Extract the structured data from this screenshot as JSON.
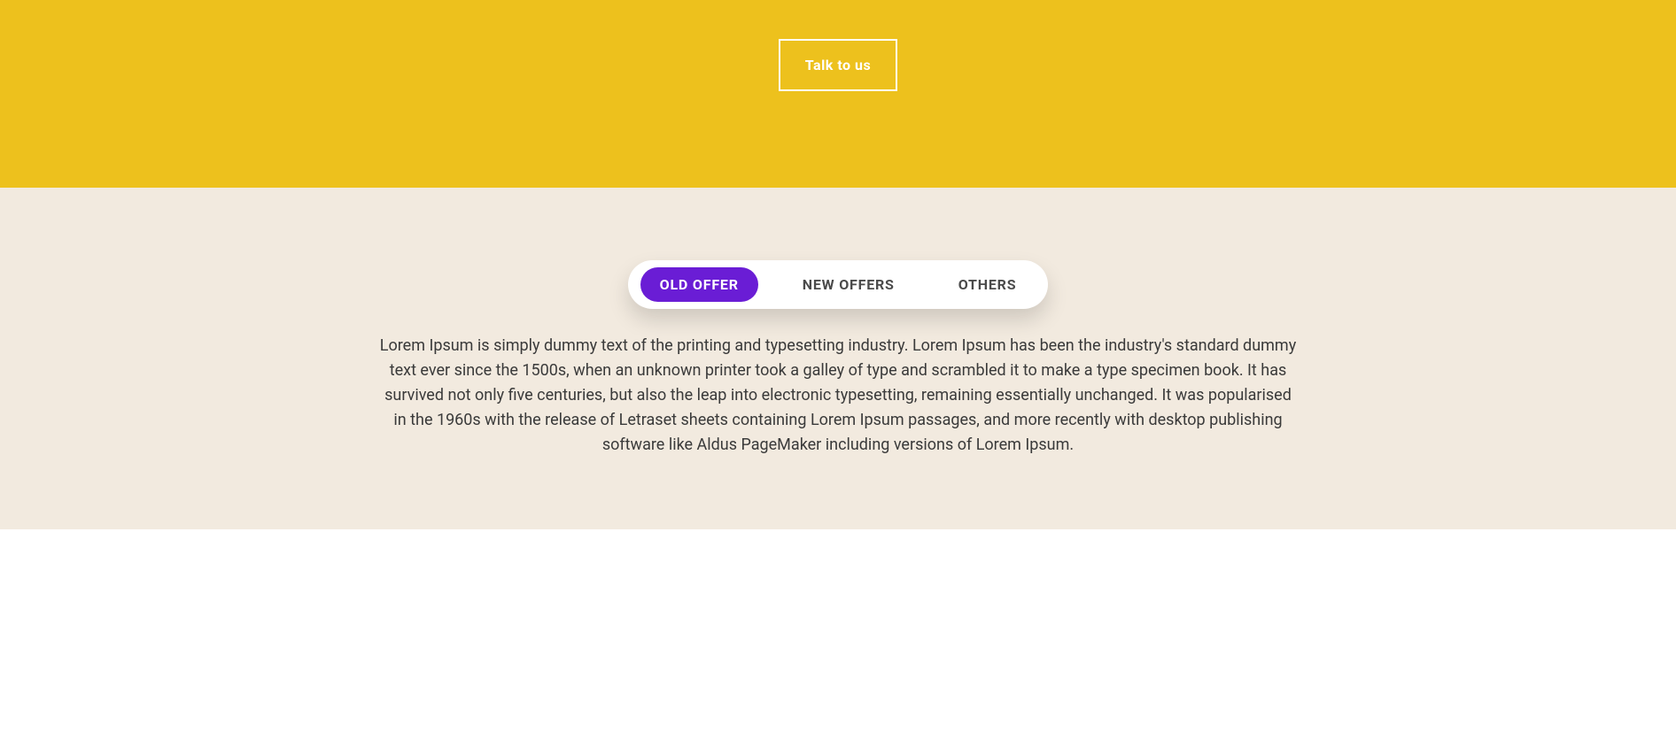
{
  "hero": {
    "cta_label": "Talk to us"
  },
  "offers": {
    "tabs": [
      {
        "label": "OLD OFFER",
        "active": true
      },
      {
        "label": "NEW OFFERS",
        "active": false
      },
      {
        "label": "OTHERS",
        "active": false
      }
    ],
    "content": "Lorem Ipsum is simply dummy text of the printing and typesetting industry. Lorem Ipsum has been the industry's standard dummy text ever since the 1500s, when an unknown printer took a galley of type and scrambled it to make a type specimen book. It has survived not only five centuries, but also the leap into electronic typesetting, remaining essentially unchanged. It was popularised in the 1960s with the release of Letraset sheets containing Lorem Ipsum passages, and more recently with desktop publishing software like Aldus PageMaker including versions of Lorem Ipsum."
  },
  "colors": {
    "hero_bg": "#edc11d",
    "offers_bg": "#f2eadf",
    "tab_active": "#6a1dd5"
  }
}
